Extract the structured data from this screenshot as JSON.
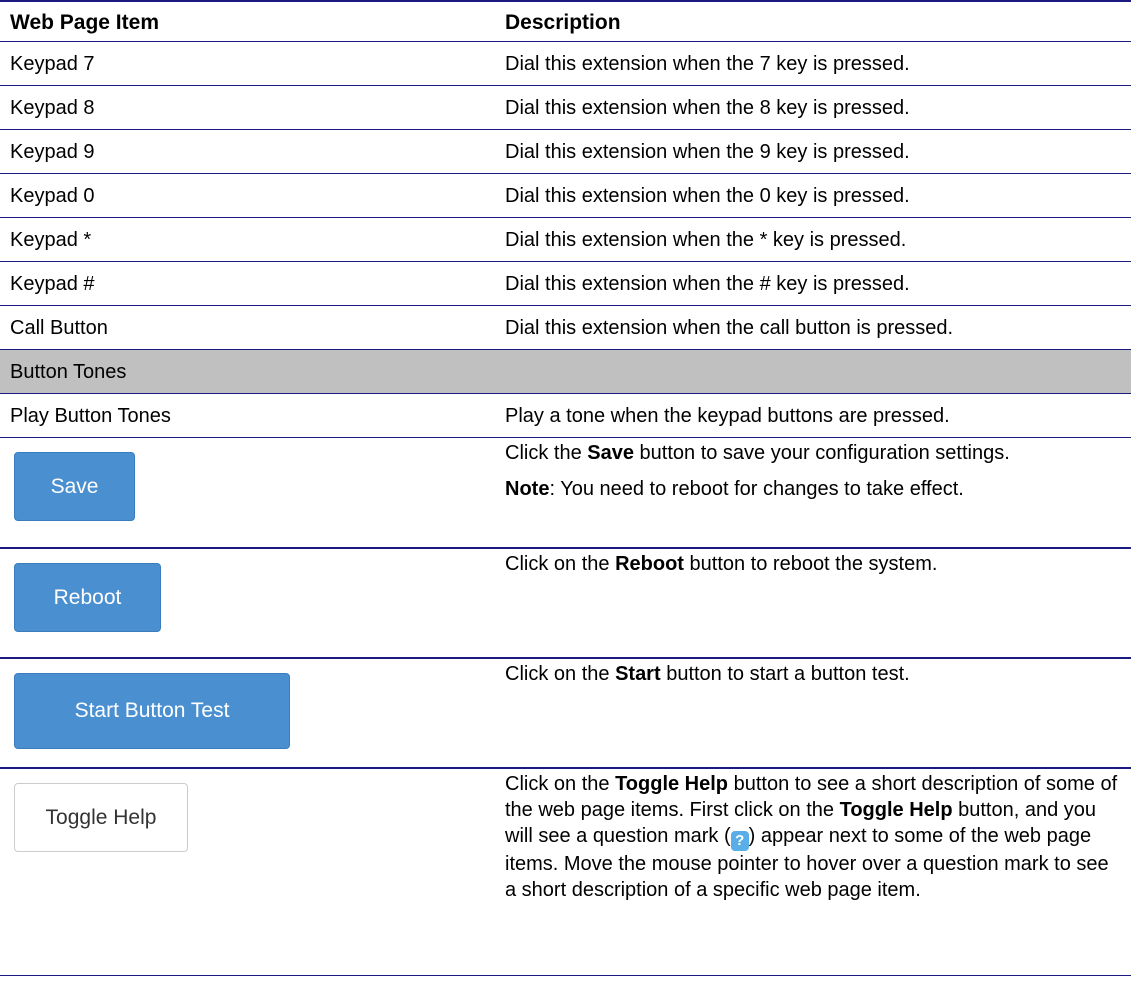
{
  "header": {
    "col1": "Web Page Item",
    "col2": "Description"
  },
  "rows": [
    {
      "item": "Keypad 7",
      "desc": "Dial this extension when the 7 key is pressed."
    },
    {
      "item": "Keypad 8",
      "desc": "Dial this extension when the 8 key is pressed."
    },
    {
      "item": "Keypad 9",
      "desc": "Dial this extension when the 9 key is pressed."
    },
    {
      "item": "Keypad 0",
      "desc": "Dial this extension when the 0 key is pressed."
    },
    {
      "item": "Keypad *",
      "desc": "Dial this extension when the * key is pressed."
    },
    {
      "item": "Keypad #",
      "desc": "Dial this extension when the # key is pressed."
    },
    {
      "item": "Call Button",
      "desc": "Dial this extension when the call button is pressed."
    }
  ],
  "section": {
    "label": "Button Tones"
  },
  "tone_row": {
    "item": "Play Button Tones",
    "desc": "Play a tone when the keypad buttons are pressed."
  },
  "save": {
    "button": "Save",
    "d1": "Click the ",
    "d1b": "Save",
    "d1c": " button to save your configuration settings.",
    "note_b": "Note",
    "note": ": You need to reboot for changes to take effect."
  },
  "reboot": {
    "button": "Reboot",
    "d1": "Click on the ",
    "d1b": "Reboot",
    "d1c": " button to reboot the system."
  },
  "start": {
    "button": "Start Button Test",
    "d1": "Click on the ",
    "d1b": "Start",
    "d1c": " button to start a button test."
  },
  "toggle": {
    "button": "Toggle Help",
    "t1": "Click on the ",
    "t1b": "Toggle Help",
    "t2": " button to see a short description of some of the web page items. First click on the ",
    "t2b": "Toggle Help",
    "t3": " button, and you will see a question mark (",
    "icon": "?",
    "t4": ") appear next to some of the web page items. Move the mouse pointer to hover over a question mark to see a short description of a specific web page item."
  },
  "colors": {
    "rule": "#1a1a80",
    "button_blue": "#4a8fd0",
    "section_gray": "#c0c0c0",
    "help_icon": "#5aaee8"
  }
}
